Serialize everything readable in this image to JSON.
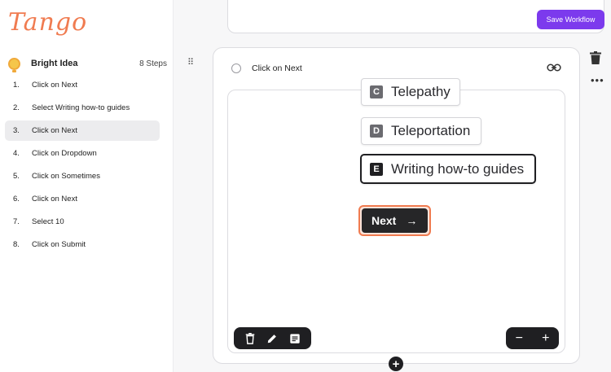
{
  "brand": {
    "logo_text": "Tango",
    "accent": "#f07b50"
  },
  "sidebar": {
    "workflow_title": "Bright Idea",
    "workflow_steps": "8 Steps",
    "steps": [
      {
        "num": "1.",
        "label": "Click on Next"
      },
      {
        "num": "2.",
        "label": "Select Writing how-to guides"
      },
      {
        "num": "3.",
        "label": "Click on Next",
        "active": true
      },
      {
        "num": "4.",
        "label": "Click on Dropdown"
      },
      {
        "num": "5.",
        "label": "Click on Sometimes"
      },
      {
        "num": "6.",
        "label": "Click on Next"
      },
      {
        "num": "7.",
        "label": "Select 10"
      },
      {
        "num": "8.",
        "label": "Click on Submit"
      }
    ]
  },
  "header": {
    "save_label": "Save Workflow",
    "save_color": "#7c3aed"
  },
  "step_card": {
    "title": "Click on Next",
    "link_icon": "link-icon",
    "delete_icon": "trash-icon",
    "more_icon": "more-icon"
  },
  "screenshot": {
    "options": [
      {
        "key": "C",
        "text": "Telepathy"
      },
      {
        "key": "D",
        "text": "Teleportation"
      },
      {
        "key": "E",
        "text": "Writing how-to guides",
        "selected": true
      }
    ],
    "next_label": "Next",
    "next_arrow": "→"
  },
  "toolbar": {
    "left_icons": [
      "trash-icon",
      "pencil-icon",
      "note-icon"
    ],
    "zoom_out": "−",
    "zoom_in": "+"
  },
  "add_step": "+"
}
